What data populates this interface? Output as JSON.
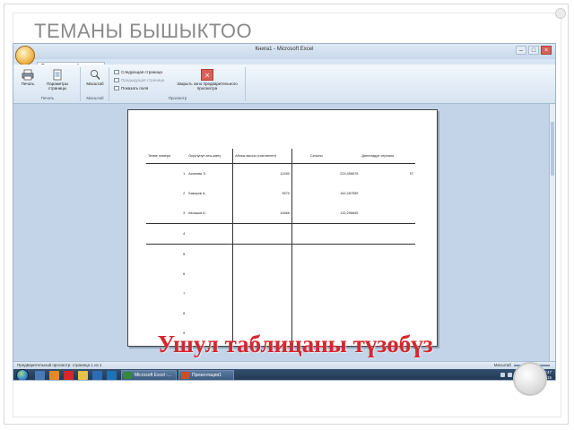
{
  "slide": {
    "title": "ТЕМАНЫ БЫШЫКТОО",
    "overlay_text": "Ушул таблицаны түзөбүз"
  },
  "window": {
    "title": "Книга1 - Microsoft Excel",
    "ribbon_tab": "Предварительный просмотр",
    "groups": [
      {
        "label": "Печать"
      },
      {
        "label": "Масштаб"
      },
      {
        "label": "Просмотр"
      }
    ],
    "buttons": {
      "print": "Печать",
      "page_setup": "Параметры страницы",
      "zoom": "Масштаб",
      "next_page": "Следующая страница",
      "prev_page": "Предыдущая страница",
      "show_margins": "Показать поля",
      "close_preview": "Закрыть окно предварительного просмотра"
    }
  },
  "document": {
    "headers": [
      "Тизме номери",
      "Окуучунун аты-жөнү",
      "Айлык акысы (сом менен)",
      "Салыгы",
      "Дипломдун сериясы"
    ],
    "rows": [
      [
        "1",
        "Асанова Э.",
        "12450",
        "224,456676",
        "57"
      ],
      [
        "2",
        "Бакиров А.",
        "9570",
        "162,287555",
        ""
      ],
      [
        "3",
        "Калыков Б.",
        "10666",
        "132,296845",
        ""
      ],
      [
        "4",
        "",
        "",
        "",
        ""
      ],
      [
        "5",
        "",
        "",
        "",
        ""
      ],
      [
        "6",
        "",
        "",
        "",
        ""
      ],
      [
        "7",
        "",
        "",
        "",
        ""
      ],
      [
        "8",
        "",
        "",
        "",
        ""
      ],
      [
        "9",
        "",
        "",
        "",
        ""
      ]
    ]
  },
  "status_bar": {
    "left": "Предварительный просмотр: страница 1 из 1",
    "zoom": "Масштаб"
  },
  "taskbar": {
    "tasks": [
      "Microsoft Excel -...",
      "Презентация1"
    ],
    "time": "22:47",
    "date": "20.09.2015"
  },
  "colors": {
    "overlay_text": "#d8262c",
    "title_gray": "#8a8a8a",
    "taskbar": "#2a4565"
  }
}
